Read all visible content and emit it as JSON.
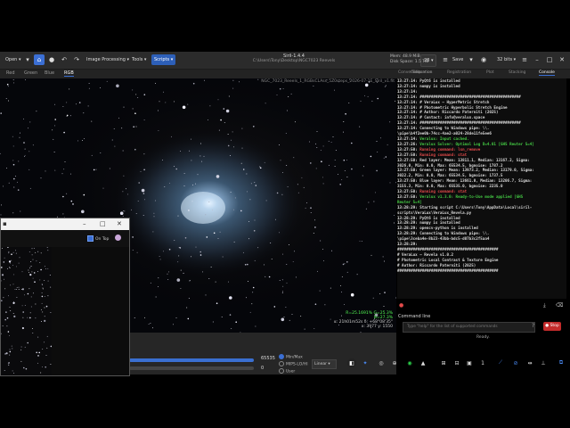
{
  "toolbar": {
    "open_label": "Open",
    "image_processing_label": "Image Processing",
    "tools_label": "Tools",
    "scripts_label": "Scripts",
    "save_label": "Save",
    "zoom_value": "28",
    "threads_label": "32 bits",
    "accent_color": "#3b6fd4"
  },
  "window": {
    "title": "Siril-1.4.4",
    "path": "C:\\Users\\Tony\\Desktop\\NGC7023 Reevels",
    "memory": "Mem: 48.9 MiB",
    "disk_space": "Disk Space: 1.5 TiB"
  },
  "left_tabs": [
    "Red",
    "Green",
    "Blue",
    "RGB"
  ],
  "image_name": "NGC_7023_Reeels_1_RGBsCLAss_5Z0steps_2026-07-1E_Siril_v1.fit",
  "pixel_readout": {
    "line1": "R=25.1691% G=25.3%",
    "line2": "B=27.3%",
    "line3": "α: 21h01m52s δ: +68°08'35\"",
    "line4": "x: 3977 y: 1550"
  },
  "right_tabs": [
    "Conversion",
    "Sequence",
    "Calibration",
    "Registration",
    "Plot",
    "Stacking",
    "Console"
  ],
  "console_lines": [
    {
      "t": "13:27:14:",
      "m": " PyQt6 is installed",
      "c": ""
    },
    {
      "t": "13:27:14:",
      "m": " numpy is installed",
      "c": ""
    },
    {
      "t": "13:27:14:",
      "m": "",
      "c": ""
    },
    {
      "t": "13:27:14:",
      "m": " #############################################",
      "c": ""
    },
    {
      "t": "13:27:14:",
      "m": " # VeraLux — HyperMetric Stretch",
      "c": ""
    },
    {
      "t": "13:27:14:",
      "m": " # Photometric Hyperbolic Stretch Engine",
      "c": ""
    },
    {
      "t": "13:27:14:",
      "m": " # Author: Riccardo Paterniti (2025)",
      "c": ""
    },
    {
      "t": "13:27:14:",
      "m": " # Contact: info@veralux.space",
      "c": ""
    },
    {
      "t": "13:27:14:",
      "m": " #############################################",
      "c": ""
    },
    {
      "t": "13:27:14:",
      "m": " Connecting to Windows pipe: \\\\.",
      "c": ""
    },
    {
      "t": "",
      "m": "\\pipe\\b4f2ee0b-74cc-4ae2-a024-28de11fe5ee6",
      "c": ""
    },
    {
      "t": "13:27:14:",
      "m": " Veralux: Input cached.",
      "c": "green"
    },
    {
      "t": "13:27:26:",
      "m": " Veralux Solver: Optimal Log D=4.01 [GHS Reuter S=4]",
      "c": "green"
    },
    {
      "t": "13:27:50:",
      "m": " Running command: lsn_remove",
      "c": "red"
    },
    {
      "t": "13:27:50:",
      "m": " Running command: stat",
      "c": "red"
    },
    {
      "t": "13:27:50:",
      "m": " Red layer: Mean: 13811.1, Median: 13167.2, Sigma:",
      "c": ""
    },
    {
      "t": "",
      "m": "3026.0, Min: 0.0, Max: 65534.5, bgnoise: 1787.2",
      "c": ""
    },
    {
      "t": "13:27:50:",
      "m": " Green layer: Mean: 13973.2, Median: 13179.0, Sigma:",
      "c": ""
    },
    {
      "t": "",
      "m": "3022.2, Min: 0.0, Max: 65534.5, bgnoise: 1737.5",
      "c": ""
    },
    {
      "t": "13:27:50:",
      "m": " Blue layer: Mean: 13661.0, Median: 13206.7, Sigma:",
      "c": ""
    },
    {
      "t": "",
      "m": "3155.3, Min: 0.0, Max: 65535.0, bgnoise: 2235.0",
      "c": ""
    },
    {
      "t": "13:27:50:",
      "m": " Running command: stat",
      "c": "red"
    },
    {
      "t": "13:27:50:",
      "m": " Veralux v1.3.0: Ready-to-Use mode applied [GHS",
      "c": "green"
    },
    {
      "t": "",
      "m": "Reuter S=4]",
      "c": "green"
    },
    {
      "t": "13:28:29:",
      "m": " Starting script C:\\Users\\Tony\\AppData\\Local\\siril-",
      "c": ""
    },
    {
      "t": "",
      "m": "scripts\\VeraLux\\VeraLux_Revela.py",
      "c": ""
    },
    {
      "t": "13:28:29:",
      "m": " PyQt6 is installed",
      "c": ""
    },
    {
      "t": "13:28:29:",
      "m": " numpy is installed",
      "c": ""
    },
    {
      "t": "13:28:29:",
      "m": " opencv-python is installed",
      "c": ""
    },
    {
      "t": "13:28:29:",
      "m": " Connecting to Windows pipe: \\\\.",
      "c": ""
    },
    {
      "t": "",
      "m": "\\pipe\\3ceba4e-8b23-43bb-bdc5-d07b3c2f5aa4",
      "c": ""
    },
    {
      "t": "13:28:29:",
      "m": "",
      "c": ""
    },
    {
      "t": "",
      "m": "#############################################",
      "c": ""
    },
    {
      "t": "",
      "m": "# VeraLux — Revela v1.0.2",
      "c": ""
    },
    {
      "t": "",
      "m": "# Photometric Local Contrast & Texture Engine",
      "c": ""
    },
    {
      "t": "",
      "m": "# Author: Riccardo Paterniti (2025)",
      "c": ""
    },
    {
      "t": "",
      "m": "#############################################",
      "c": ""
    }
  ],
  "command_line": {
    "header": "Command line",
    "placeholder": "Type \"help\" for the list of supported commands",
    "stop_label": "Stop",
    "status": "Ready."
  },
  "display": {
    "max_value": "65535",
    "min_value": "0",
    "mode_minmax": "Min/Max",
    "mode_mips": "MIPS-LO/HI",
    "mode_user": "User",
    "scale": "Linear"
  },
  "float_window": {
    "ontop_label": "On Top"
  }
}
